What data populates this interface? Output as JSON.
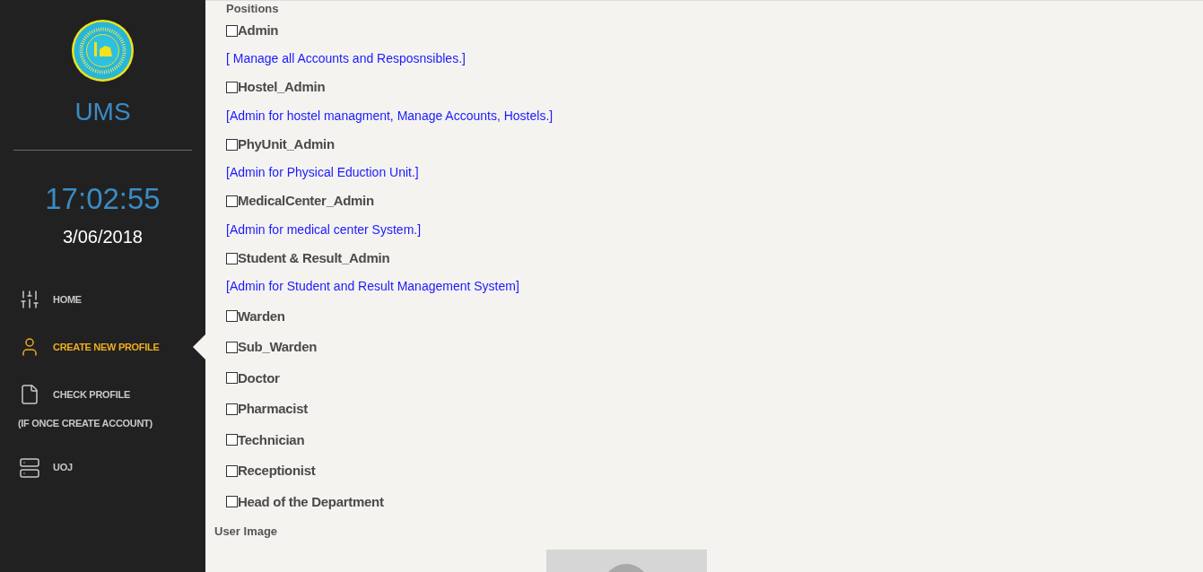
{
  "sidebar": {
    "title": "UMS",
    "time": "17:02:55",
    "date": "3/06/2018",
    "nav": [
      {
        "kind": "home",
        "label": "HOME",
        "selected": false
      },
      {
        "kind": "user",
        "label": "CREATE NEW PROFILE",
        "selected": true
      },
      {
        "kind": "file",
        "label": "CHECK PROFILE",
        "note": "(IF ONCE CREATE ACCOUNT)",
        "selected": false
      },
      {
        "kind": "list",
        "label": "UOJ",
        "selected": false
      }
    ]
  },
  "positions": {
    "label": "Positions",
    "items": [
      {
        "label": "Admin",
        "checked": false,
        "description": "[ Manage all Accounts and Resposnsibles.]"
      },
      {
        "label": "Hostel_Admin",
        "checked": false,
        "description": "[Admin for hostel managment, Manage Accounts, Hostels.]"
      },
      {
        "label": "PhyUnit_Admin",
        "checked": false,
        "description": "[Admin for Physical Eduction Unit.]"
      },
      {
        "label": "MedicalCenter_Admin",
        "checked": false,
        "description": "[Admin for medical center System.]"
      },
      {
        "label": "Student & Result_Admin",
        "checked": false,
        "description": "[Admin for Student and Result Management System]"
      },
      {
        "label": "Warden",
        "checked": false
      },
      {
        "label": "Sub_Warden",
        "checked": false
      },
      {
        "label": "Doctor",
        "checked": false
      },
      {
        "label": "Pharmacist",
        "checked": false
      },
      {
        "label": "Technician",
        "checked": false
      },
      {
        "label": "Receptionist",
        "checked": false
      },
      {
        "label": "Head of the Department",
        "checked": false
      }
    ]
  },
  "user_image": {
    "label": "User Image"
  }
}
